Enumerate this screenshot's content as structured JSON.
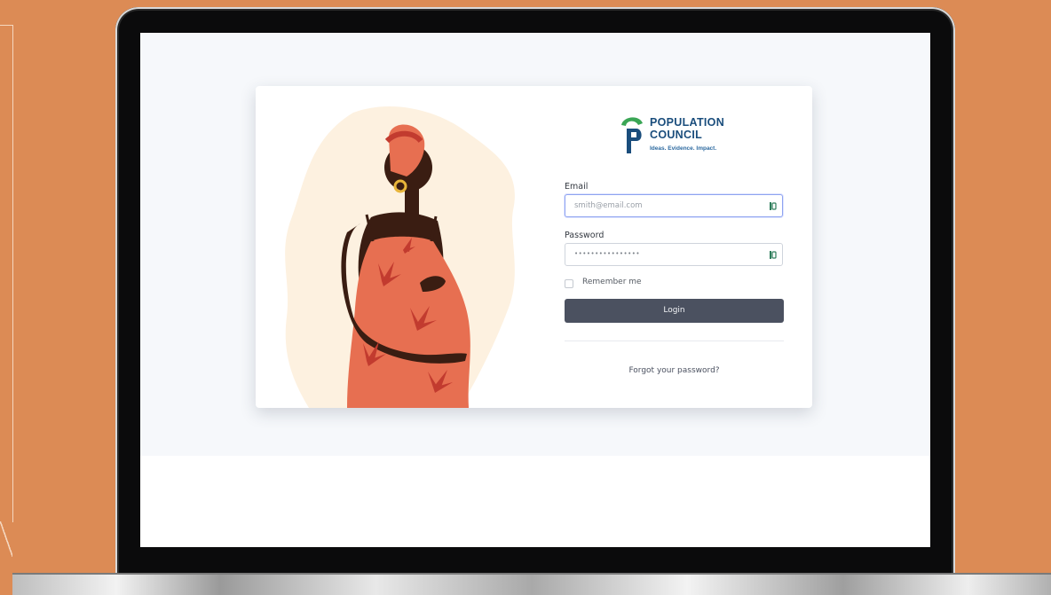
{
  "logo": {
    "line1": "POPULATION",
    "line2": "COUNCIL",
    "tagline": "Ideas. Evidence. Impact."
  },
  "form": {
    "email_label": "Email",
    "email_placeholder": "smith@email.com",
    "password_label": "Password",
    "password_value": "••••••••••••••••",
    "remember_label": "Remember me",
    "login_label": "Login",
    "forgot_label": "Forgot your password?"
  },
  "colors": {
    "page_background": "#dc8b55",
    "button": "#4b5160",
    "brand_blue": "#1a4d7c",
    "brand_green": "#3aa655"
  },
  "icons": {
    "field_icon": "password-manager-icon",
    "logo_mark": "population-council-logo"
  }
}
